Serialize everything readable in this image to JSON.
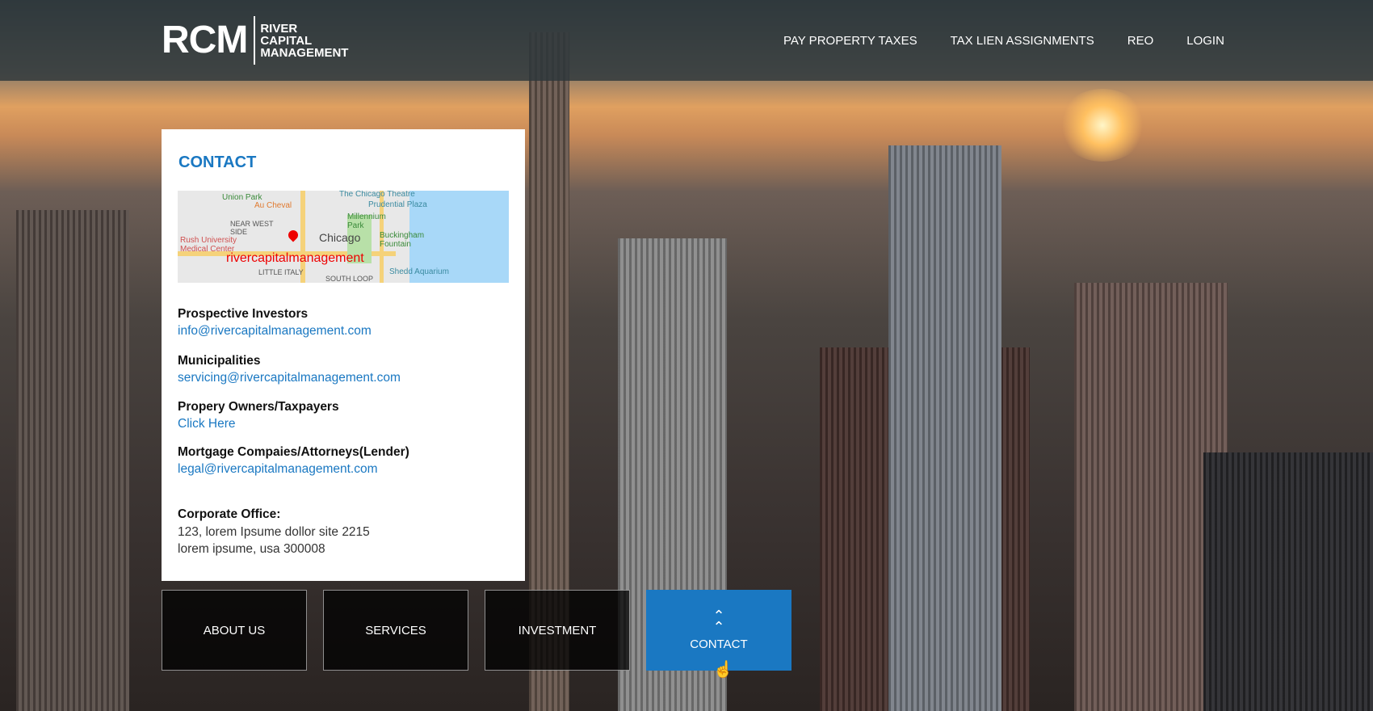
{
  "header": {
    "logo": {
      "abbr": "RCM",
      "line1": "RIVER",
      "line2": "CAPITAL",
      "line3": "MANAGEMENT"
    },
    "nav": [
      "PAY PROPERTY TAXES",
      "TAX LIEN ASSIGNMENTS",
      "REO",
      "LOGIN"
    ]
  },
  "contact": {
    "title": "CONTACT",
    "map": {
      "brand": "rivercapitalmanagement",
      "labels": [
        "Union Park",
        "Au Cheval",
        "The Chicago Theatre",
        "Prudential Plaza",
        "Millennium Park",
        "NEAR WEST SIDE",
        "Chicago",
        "Buckingham Fountain",
        "Rush University Medical Center",
        "LITTLE ITALY",
        "SOUTH LOOP",
        "Shedd Aquarium"
      ]
    },
    "sections": [
      {
        "heading": "Prospective Investors",
        "link": "info@rivercapitalmanagement.com"
      },
      {
        "heading": "Municipalities",
        "link": "servicing@rivercapitalmanagement.com"
      },
      {
        "heading": "Propery Owners/Taxpayers",
        "link": "Click Here"
      },
      {
        "heading": "Mortgage Compaies/Attorneys(Lender)",
        "link": "legal@rivercapitalmanagement.com"
      }
    ],
    "office": {
      "heading": "Corporate Office:",
      "line1": "123, lorem Ipsume dollor site 2215",
      "line2": "lorem ipsume, usa 300008"
    }
  },
  "tiles": [
    "ABOUT US",
    "SERVICES",
    "INVESTMENT",
    "CONTACT"
  ],
  "colors": {
    "accent": "#1a78c2"
  }
}
